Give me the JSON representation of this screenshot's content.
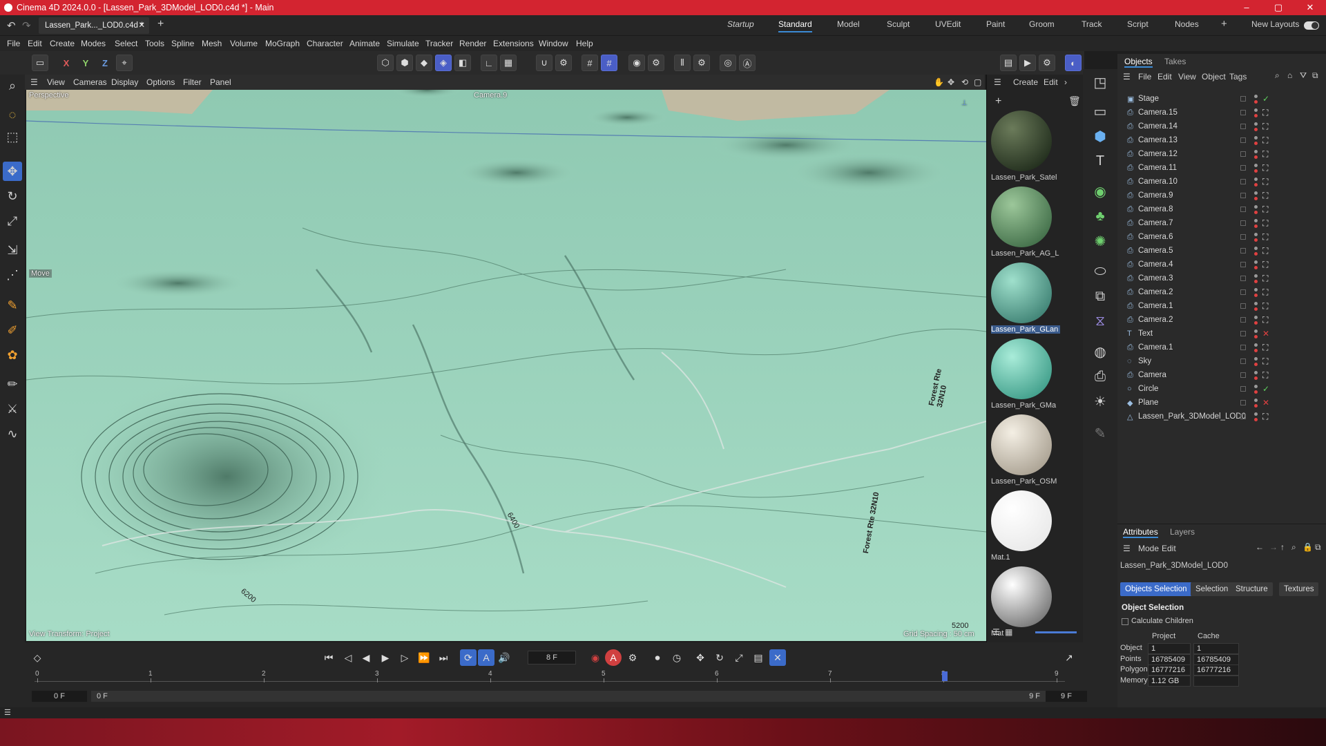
{
  "window": {
    "title": "Cinema 4D 2024.0.0 - [Lassen_Park_3DModel_LOD0.c4d *] - Main",
    "minimize": "–",
    "maximize": "▢",
    "close": "✕"
  },
  "tabs": {
    "document": "Lassen_Park..._LOD0.c4d *",
    "close": "✕",
    "add": "+",
    "layouts": [
      "Startup",
      "Standard",
      "Model",
      "Sculpt",
      "UVEdit",
      "Paint",
      "Groom",
      "Track",
      "Script",
      "Nodes"
    ],
    "active_layout": "Standard",
    "plus": "+",
    "new_layouts": "New Layouts"
  },
  "menu": [
    "File",
    "Edit",
    "Create",
    "Modes",
    "Select",
    "Tools",
    "Spline",
    "Mesh",
    "Volume",
    "MoGraph",
    "Character",
    "Animate",
    "Simulate",
    "Tracker",
    "Render",
    "Extensions",
    "Window",
    "Help"
  ],
  "toolbar": {
    "x": "X",
    "y": "Y",
    "z": "Z"
  },
  "viewport": {
    "menu": [
      "View",
      "Cameras",
      "Display",
      "Options",
      "Filter",
      "Panel"
    ],
    "projection": "Perspective",
    "camera": "Camera.9",
    "tool_label": "Move",
    "view_transform": "View Transform: Project",
    "grid_spacing": "Grid Spacing : 50 cm",
    "map_labels": [
      "Forest Rte 32N10",
      "Forest Rte 32N10",
      "6400",
      "6200",
      "5200",
      "6400"
    ],
    "terrain_color": "#9fd6bf"
  },
  "materials": {
    "menu": [
      "Create",
      "Edit"
    ],
    "items": [
      {
        "name": "Lassen_Park_Satel",
        "c1": "#6b7b5a",
        "c2": "#1e2a1a"
      },
      {
        "name": "Lassen_Park_AG_L",
        "c1": "#9cc79a",
        "c2": "#3d6a45"
      },
      {
        "name": "Lassen_Park_GLan",
        "c1": "#9fe0cc",
        "c2": "#3a7d70"
      },
      {
        "name": "Lassen_Park_GMa",
        "c1": "#a9ecd9",
        "c2": "#3a9a86"
      },
      {
        "name": "Lassen_Park_OSM",
        "c1": "#f4efe4",
        "c2": "#a69d8e"
      },
      {
        "name": "Mat.1",
        "c1": "#ffffff",
        "c2": "#e8e8e8"
      },
      {
        "name": "Mat",
        "c1": "#ffffff",
        "c2": "#6f6f6f"
      }
    ],
    "selected": "Lassen_Park_GLan"
  },
  "objects": {
    "tabs": [
      "Objects",
      "Takes"
    ],
    "menu": [
      "File",
      "Edit",
      "View",
      "Object",
      "Tags"
    ],
    "rows": [
      "Stage",
      "Camera.15",
      "Camera.14",
      "Camera.13",
      "Camera.12",
      "Camera.11",
      "Camera.10",
      "Camera.9",
      "Camera.8",
      "Camera.7",
      "Camera.6",
      "Camera.5",
      "Camera.4",
      "Camera.3",
      "Camera.2",
      "Camera.1",
      "Camera.2",
      "Text",
      "Camera.1",
      "Sky",
      "Camera",
      "Circle",
      "Plane",
      "Lassen_Park_3DModel_LOD0"
    ]
  },
  "attributes": {
    "tabs": [
      "Attributes",
      "Layers"
    ],
    "menu": [
      "Mode",
      "Edit"
    ],
    "object_name": "Lassen_Park_3DModel_LOD0",
    "buttons": [
      "Objects Selection",
      "Selection",
      "Structure",
      "Textures"
    ],
    "section": "Object Selection",
    "calculate_children": "Calculate Children",
    "col_project": "Project",
    "col_cache": "Cache",
    "rows": [
      {
        "label": "Object",
        "project": "1",
        "cache": "1"
      },
      {
        "label": "Points",
        "project": "16785409",
        "cache": "16785409"
      },
      {
        "label": "Polygons",
        "project": "16777216",
        "cache": "16777216"
      },
      {
        "label": "Memory",
        "project": "1.12 GB",
        "cache": ""
      }
    ]
  },
  "timeline": {
    "current_frame": "8 F",
    "ticks": [
      "0",
      "1",
      "2",
      "3",
      "4",
      "5",
      "6",
      "7",
      "8",
      "9"
    ],
    "start": "0 F",
    "start2": "0 F",
    "end": "9 F",
    "end2": "9 F",
    "current": 8,
    "max": 9
  }
}
